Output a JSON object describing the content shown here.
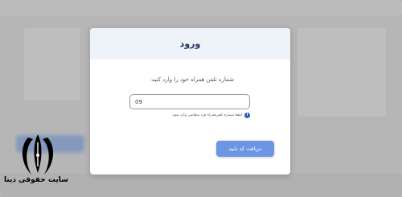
{
  "modal": {
    "title": "ورود",
    "prompt": "شماره تلفن همراه خود را وارد کنید:",
    "phone_input": {
      "value": "09",
      "placeholder": ""
    },
    "hint": "لطفا شماره تلفن‌همراه فرد متقاضی وارد شود.",
    "submit_label": "دریافت کد تایید",
    "colors": {
      "header_bg": "#eef2f9",
      "button": "#6c96e3",
      "info": "#2c57c4"
    }
  },
  "watermark": {
    "text": "سایت حقوقی دینا",
    "logo_icon": "pen-nib-emblem-icon"
  }
}
